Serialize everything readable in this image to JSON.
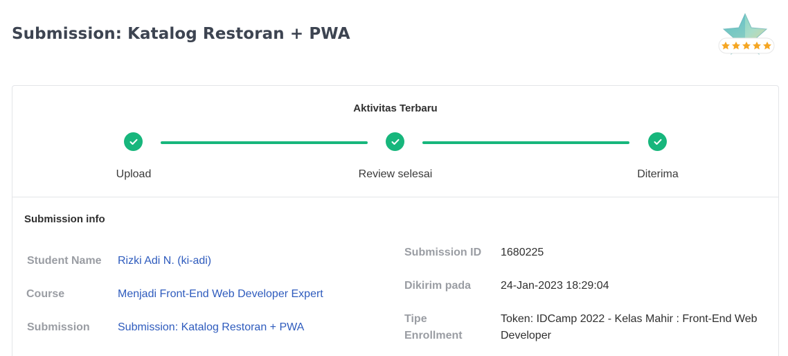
{
  "page": {
    "title": "Submission: Katalog Restoran + PWA"
  },
  "activity": {
    "title": "Aktivitas Terbaru",
    "steps": [
      {
        "label": "Upload"
      },
      {
        "label": "Review selesai"
      },
      {
        "label": "Diterima"
      }
    ],
    "color": "#17b67c"
  },
  "submission_info": {
    "title": "Submission info",
    "left": [
      {
        "label": "Student Name",
        "value": "Rizki Adi N. (ki-adi)"
      },
      {
        "label": "Course",
        "value": "Menjadi Front-End Web Developer Expert"
      },
      {
        "label": "Submission",
        "value": "Submission: Katalog Restoran + PWA"
      }
    ],
    "right": [
      {
        "label": "Submission ID",
        "value": "1680225"
      },
      {
        "label": "Dikirim pada",
        "value": "24-Jan-2023 18:29:04"
      },
      {
        "label_line1": "Tipe",
        "label_line2": "Enrollment",
        "value_line1": "Token: IDCamp 2022 - Kelas Mahir : Front-End Web",
        "value_line2": "Developer"
      }
    ]
  },
  "badge": {
    "icon": "star-rating-badge-icon",
    "stars": 5
  }
}
